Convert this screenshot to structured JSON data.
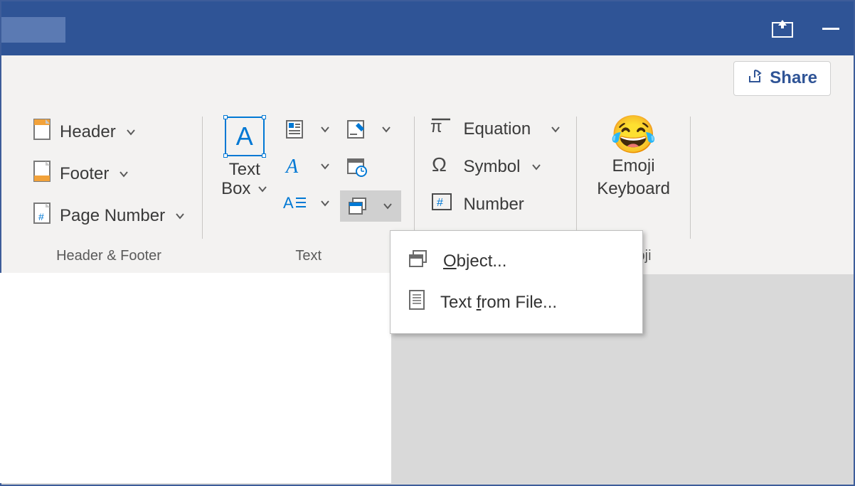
{
  "share_label": "Share",
  "groups": {
    "header_footer": {
      "label": "Header & Footer",
      "header": "Header",
      "footer": "Footer",
      "page_number": "Page Number"
    },
    "text": {
      "label": "Text",
      "text_box_line1": "Text",
      "text_box_line2": "Box"
    },
    "symbols": {
      "equation": "Equation",
      "symbol": "Symbol",
      "number": "Number"
    },
    "emoji": {
      "label": "Emoji",
      "line1": "Emoji",
      "line2": "Keyboard"
    }
  },
  "dropdown": {
    "object_pre": "",
    "object_under": "O",
    "object_post": "bject...",
    "file_pre": "Text ",
    "file_under": "f",
    "file_post": "rom File..."
  }
}
